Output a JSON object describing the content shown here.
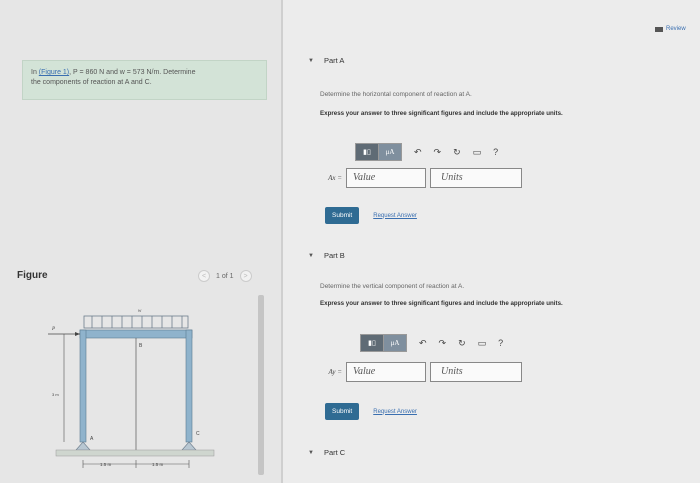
{
  "header": {
    "review_label": "Review"
  },
  "problem": {
    "prefix": "In ",
    "figure_link": "(Figure 1)",
    "p_text": ", P = 860 N and w = 573 N/m. Determine",
    "line2": "the components of reaction at A and C."
  },
  "figure": {
    "label": "Figure",
    "pager": {
      "current": "1 of 1",
      "prev": "<",
      "next": ">"
    },
    "diagram": {
      "load_label": "w",
      "force_label": "P",
      "point_b": "B",
      "point_a": "A",
      "point_c": "C",
      "height_label": "3 m",
      "dim_left": "1.5 m",
      "dim_right": "1.5 m"
    }
  },
  "parts": [
    {
      "title": "Part A",
      "question": "Determine the horizontal component of reaction at A.",
      "instruction": "Express your answer to three significant figures and include the appropriate units.",
      "answer_label": "Ax =",
      "value_placeholder": "Value",
      "units_placeholder": "Units",
      "submit": "Submit",
      "request": "Request Answer"
    },
    {
      "title": "Part B",
      "question": "Determine the vertical component of reaction at A.",
      "instruction": "Express your answer to three significant figures and include the appropriate units.",
      "answer_label": "Ay =",
      "value_placeholder": "Value",
      "units_placeholder": "Units",
      "submit": "Submit",
      "request": "Request Answer"
    },
    {
      "title": "Part C"
    }
  ],
  "toolbar": {
    "mu_label": "μA",
    "help": "?"
  },
  "icons": [
    "caret-down-icon",
    "template-icon",
    "undo-icon",
    "redo-icon",
    "reset-icon",
    "keyboard-icon",
    "help-icon"
  ]
}
